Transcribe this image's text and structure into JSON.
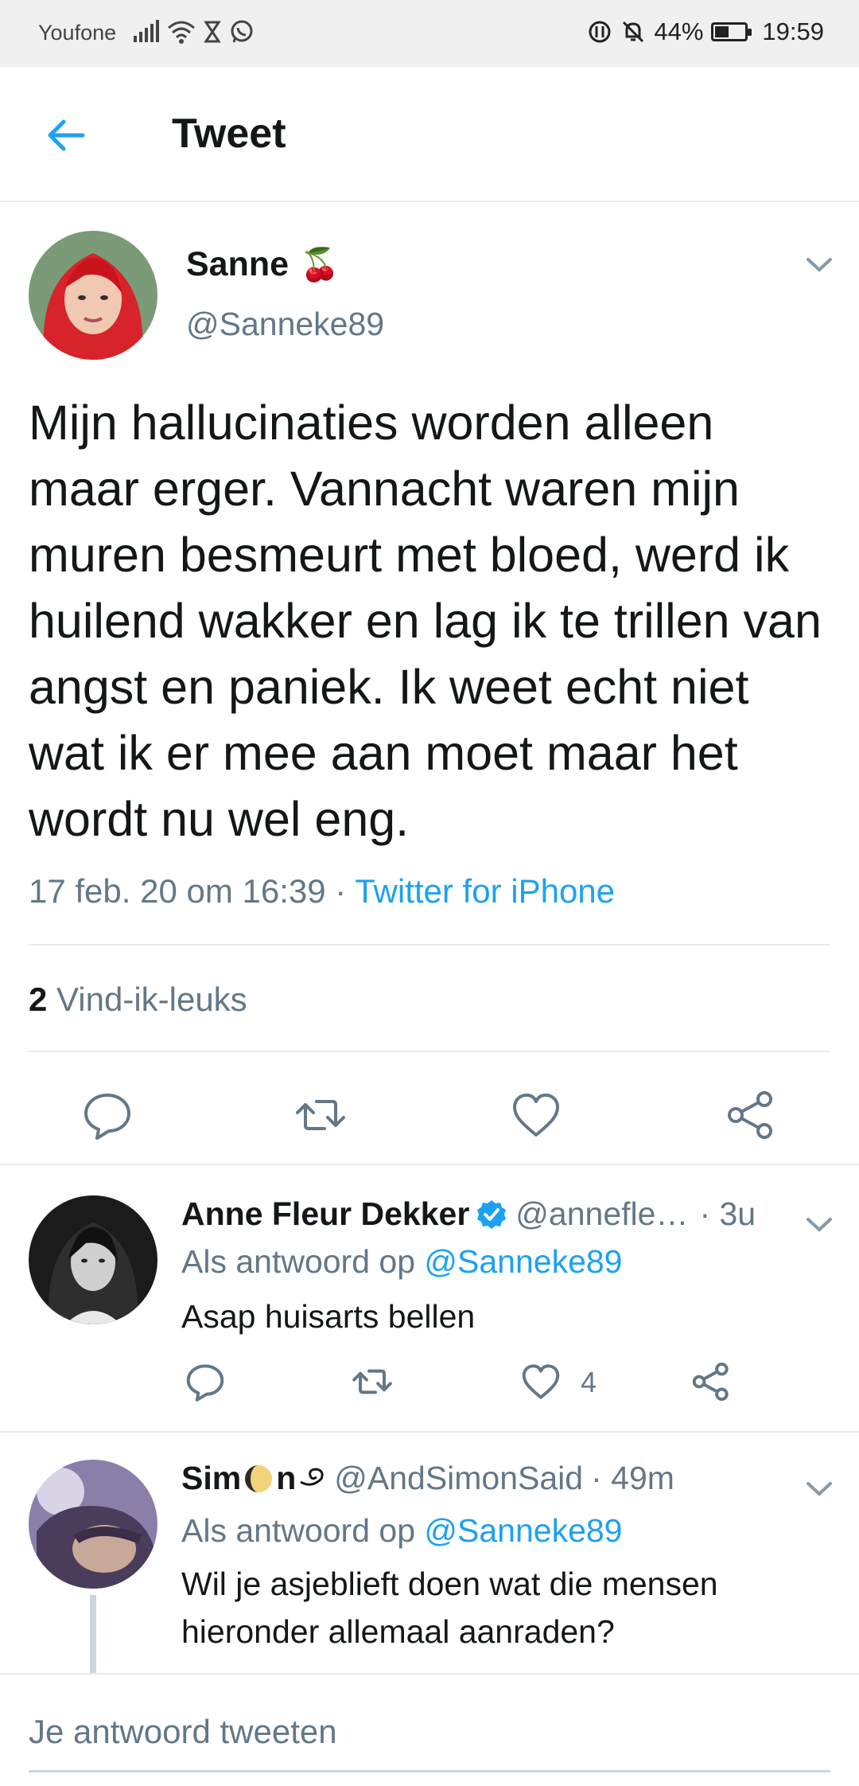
{
  "status_bar": {
    "carrier": "Youfone",
    "battery": "44%",
    "battery_level": 0.44,
    "time": "19:59"
  },
  "header": {
    "title": "Tweet"
  },
  "tweet": {
    "author_name": "Sanne",
    "author_emoji": "🍒",
    "author_handle": "@Sanneke89",
    "text": "Mijn hallucinaties worden alleen maar erger. Vannacht waren mijn muren besmeurt met bloed, werd ik huilend wakker en lag ik te trillen van angst en paniek. Ik weet echt niet wat ik er mee aan moet maar het wordt nu wel eng.",
    "timestamp": "17 feb. 20 om 16:39",
    "separator": " · ",
    "source": "Twitter for iPhone",
    "likes_count": "2",
    "likes_label": "Vind-ik-leuks"
  },
  "replies": [
    {
      "name": "Anne Fleur Dekker",
      "verified": true,
      "handle": "@annefle…",
      "time": "· 3u",
      "replying_prefix": "Als antwoord op ",
      "replying_to": "@Sanneke89",
      "text": "Asap huisarts bellen",
      "like_count": "4"
    },
    {
      "name_part1": "Sim",
      "name_part2": "n",
      "handle": "@AndSimonSaid",
      "time": "· 49m",
      "replying_prefix": "Als antwoord op ",
      "replying_to": "@Sanneke89",
      "text": "Wil je asjeblieft doen wat die mensen hieronder allemaal aanraden?"
    }
  ],
  "compose": {
    "placeholder": "Je antwoord tweeten"
  },
  "colors": {
    "accent": "#1da1f2",
    "secondary_text": "#657786",
    "divider": "#e6ecf0"
  }
}
